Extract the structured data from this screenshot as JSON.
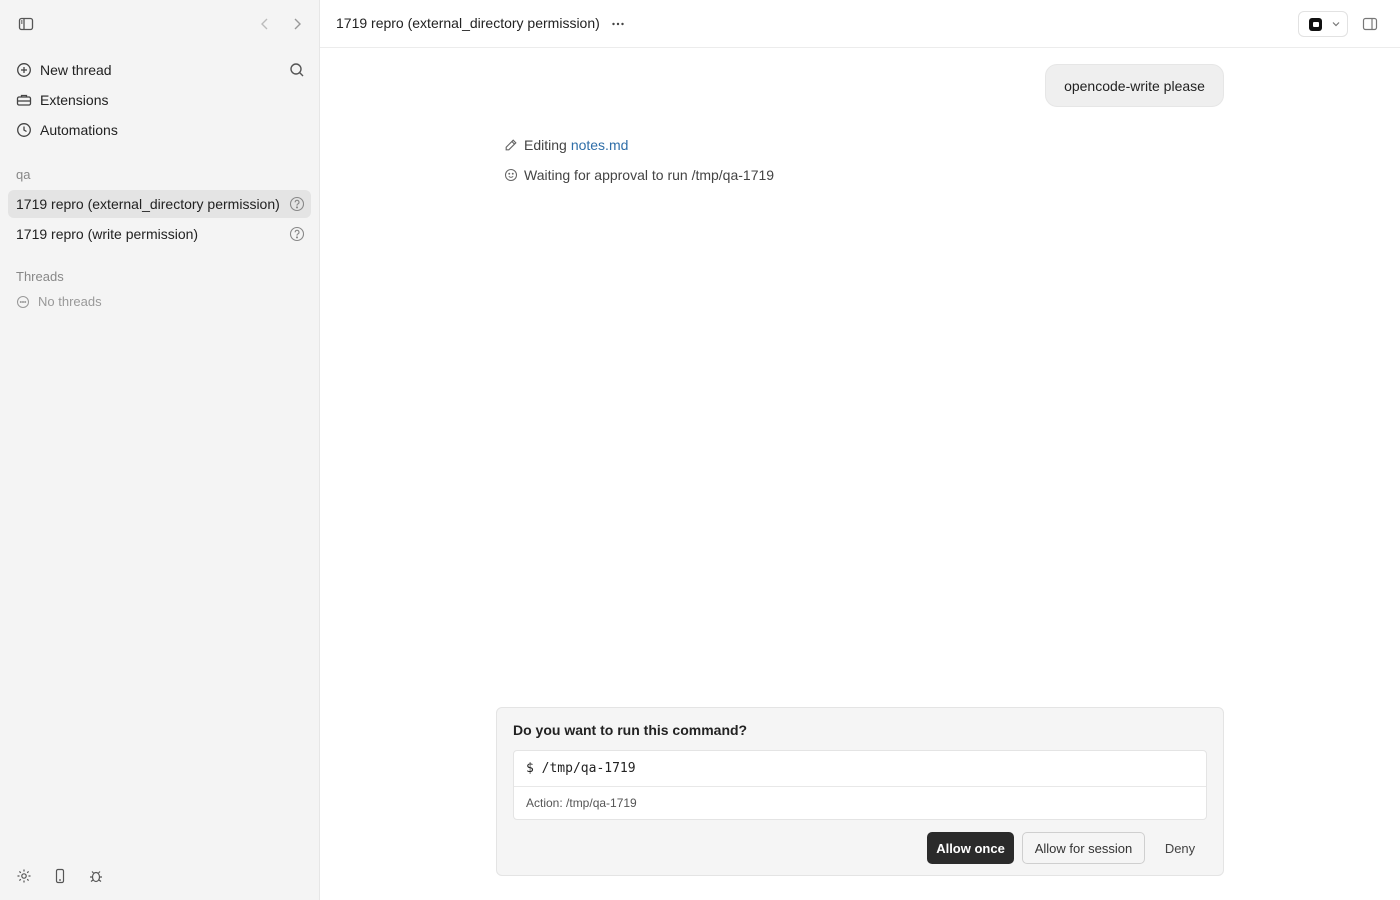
{
  "sidebar": {
    "nav": [
      {
        "label": "New thread",
        "icon": "plus-circle-icon"
      },
      {
        "label": "Extensions",
        "icon": "toolbox-icon"
      },
      {
        "label": "Automations",
        "icon": "clock-icon"
      }
    ],
    "project_label": "qa",
    "project_threads": [
      {
        "title": "1719 repro (external_directory permission)",
        "status_icon": "question-circle-icon"
      },
      {
        "title": "1719 repro (write permission)",
        "status_icon": "question-circle-icon"
      }
    ],
    "threads_label": "Threads",
    "empty_threads": "No threads"
  },
  "header": {
    "title": "1719 repro (external_directory permission)"
  },
  "conversation": {
    "user_message": "opencode-write please",
    "activity": [
      {
        "prefix": "Editing",
        "link": "notes.md",
        "icon": "pencil-icon"
      },
      {
        "prefix": "Waiting for approval to run /tmp/qa-1719",
        "icon": "clock-face-icon"
      }
    ]
  },
  "approval": {
    "question": "Do you want to run this command?",
    "command": "$ /tmp/qa-1719",
    "action": "Action: /tmp/qa-1719",
    "buttons": {
      "allow_once": "Allow once",
      "allow_session": "Allow for session",
      "deny": "Deny"
    }
  },
  "colors": {
    "sidebar_bg": "#f4f4f4",
    "active_thread_bg": "#e4e4e4",
    "link": "#2f6ea8",
    "primary_button": "#2b2b2b"
  }
}
